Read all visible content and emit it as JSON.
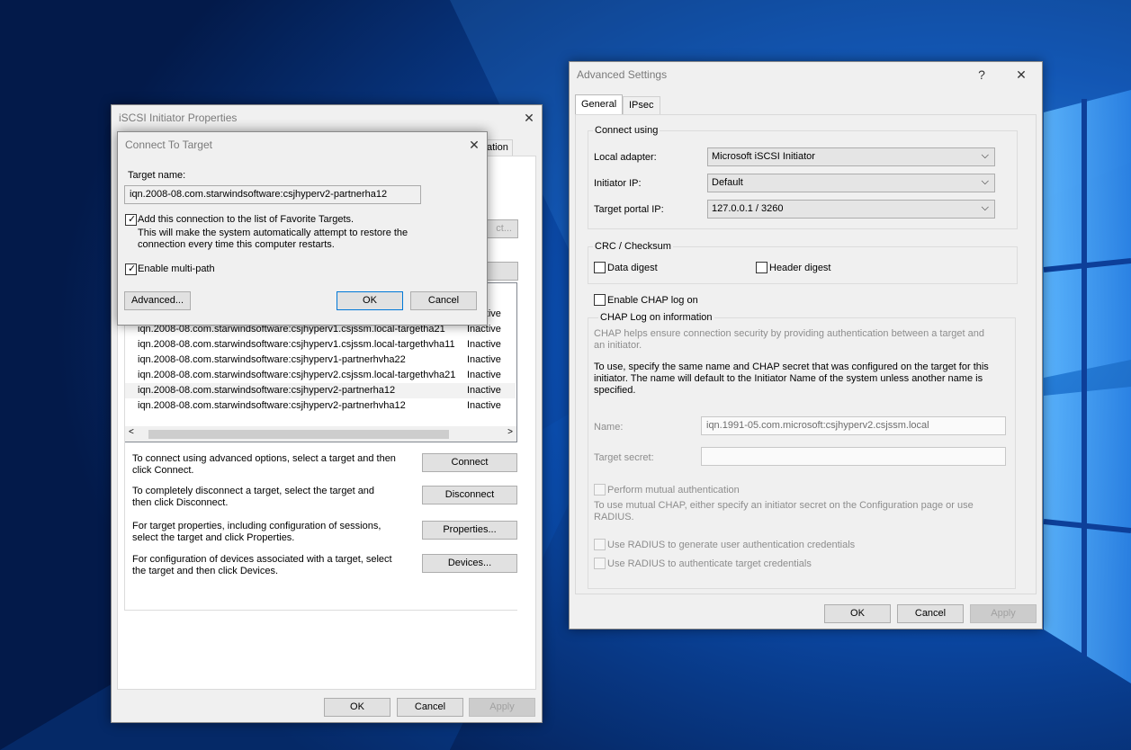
{
  "iscsi": {
    "title": "iSCSI Initiator Properties",
    "tab_partial": "ation",
    "button_partial": "ct...",
    "list_header_partial": "us",
    "targets": [
      {
        "name": "",
        "status": "Inactive"
      },
      {
        "name": "iqn.2008-08.com.starwindsoftware:csjhyperv1.csjssm.local-targetha21",
        "status": "Inactive"
      },
      {
        "name": "iqn.2008-08.com.starwindsoftware:csjhyperv1.csjssm.local-targethvha11",
        "status": "Inactive"
      },
      {
        "name": "iqn.2008-08.com.starwindsoftware:csjhyperv1-partnerhvha22",
        "status": "Inactive"
      },
      {
        "name": "iqn.2008-08.com.starwindsoftware:csjhyperv2.csjssm.local-targethvha21",
        "status": "Inactive"
      },
      {
        "name": "iqn.2008-08.com.starwindsoftware:csjhyperv2-partnerha12",
        "status": "Inactive"
      },
      {
        "name": "iqn.2008-08.com.starwindsoftware:csjhyperv2-partnerhvha12",
        "status": "Inactive"
      }
    ],
    "actions": [
      {
        "text": "To connect using advanced options, select a target and then click Connect.",
        "button": "Connect"
      },
      {
        "text": "To completely disconnect a target, select the target and then click Disconnect.",
        "button": "Disconnect"
      },
      {
        "text": "For target properties, including configuration of sessions, select the target and click Properties.",
        "button": "Properties..."
      },
      {
        "text": "For configuration of devices associated with a target, select the target and then click Devices.",
        "button": "Devices..."
      }
    ],
    "ok": "OK",
    "cancel": "Cancel",
    "apply": "Apply"
  },
  "connect": {
    "title": "Connect To Target",
    "target_name_label": "Target name:",
    "target_name_value": "iqn.2008-08.com.starwindsoftware:csjhyperv2-partnerha12",
    "favorite_label": "Add this connection to the list of Favorite Targets.",
    "favorite_desc": "This will make the system automatically attempt to restore the connection every time this computer restarts.",
    "multipath_label": "Enable multi-path",
    "advanced": "Advanced...",
    "ok": "OK",
    "cancel": "Cancel"
  },
  "advanced": {
    "title": "Advanced Settings",
    "help": "?",
    "tabs": [
      "General",
      "IPsec"
    ],
    "connect_using": "Connect using",
    "local_adapter_label": "Local adapter:",
    "local_adapter_value": "Microsoft iSCSI Initiator",
    "initiator_ip_label": "Initiator IP:",
    "initiator_ip_value": "Default",
    "portal_ip_label": "Target portal IP:",
    "portal_ip_value": "127.0.0.1 / 3260",
    "crc_group": "CRC / Checksum",
    "data_digest": "Data digest",
    "header_digest": "Header digest",
    "enable_chap": "Enable CHAP log on",
    "chap_group": "CHAP Log on information",
    "chap_help": "CHAP helps ensure connection security by providing authentication between a target and an initiator.",
    "chap_instr": "To use, specify the same name and CHAP secret that was configured on the target for this initiator.  The name will default to the Initiator Name of the system unless another name is specified.",
    "name_label": "Name:",
    "name_value": "iqn.1991-05.com.microsoft:csjhyperv2.csjssm.local",
    "secret_label": "Target secret:",
    "mutual_label": "Perform mutual authentication",
    "mutual_desc": "To use mutual CHAP, either specify an initiator secret on the Configuration page or use RADIUS.",
    "radius1": "Use RADIUS to generate user authentication credentials",
    "radius2": "Use RADIUS to authenticate target credentials",
    "ok": "OK",
    "cancel": "Cancel",
    "apply": "Apply"
  },
  "icons": {
    "close": "✕",
    "check": "✓",
    "chevron_down": "⌵",
    "arrow_left": "<",
    "arrow_right": ">"
  }
}
